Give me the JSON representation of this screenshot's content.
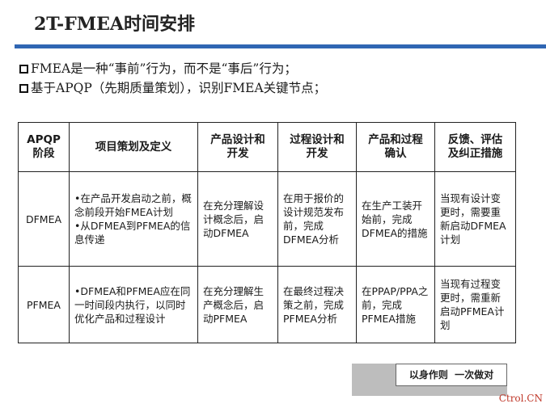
{
  "title": "2T-FMEA时间安排",
  "bullets": [
    "FMEA是一种“事前”行为，而不是“事后”行为；",
    "基于APQP（先期质量策划），识别FMEA关键节点；"
  ],
  "table": {
    "headers": [
      [
        "APQP",
        "阶段"
      ],
      [
        "项目策划及定义"
      ],
      [
        "产品设计和",
        "开发"
      ],
      [
        "过程设计和",
        "开发"
      ],
      [
        "产品和过程",
        "确认"
      ],
      [
        "反馈、评估",
        "及纠正措施"
      ]
    ],
    "rows": [
      {
        "stage": "DFMEA",
        "planning": [
          "•在产品开发启动之前，概念前段开始FMEA计划",
          "•从DFMEA到PFMEA的信息传递"
        ],
        "product_design": "在充分理解设计概念后，启动DFMEA",
        "process_design": "在用于报价的设计规范发布前，完成DFMEA分析",
        "validation": "在生产工装开始前，完成DFMEA的措施",
        "feedback": "当现有设计变更时，需要重新启动DFMEA计划"
      },
      {
        "stage": "PFMEA",
        "planning": [
          "•DFMEA和PFMEA应在同一时间段内执行，以同时优化产品和过程设计"
        ],
        "product_design": "在充分理解生产概念后，启动PFMEA",
        "process_design": "在最终过程决策之前，完成PFMEA分析",
        "validation": "在PPAP/PPA之前，完成PFMEA措施",
        "feedback": "当现有过程变更时，需重新启动PFMEA计划"
      }
    ]
  },
  "stamp_text": "以身作则  一次做对",
  "watermark": "Ctrol.CN",
  "colors": {
    "accent_rule": "#2f66b3",
    "watermark": "#c0392b"
  }
}
